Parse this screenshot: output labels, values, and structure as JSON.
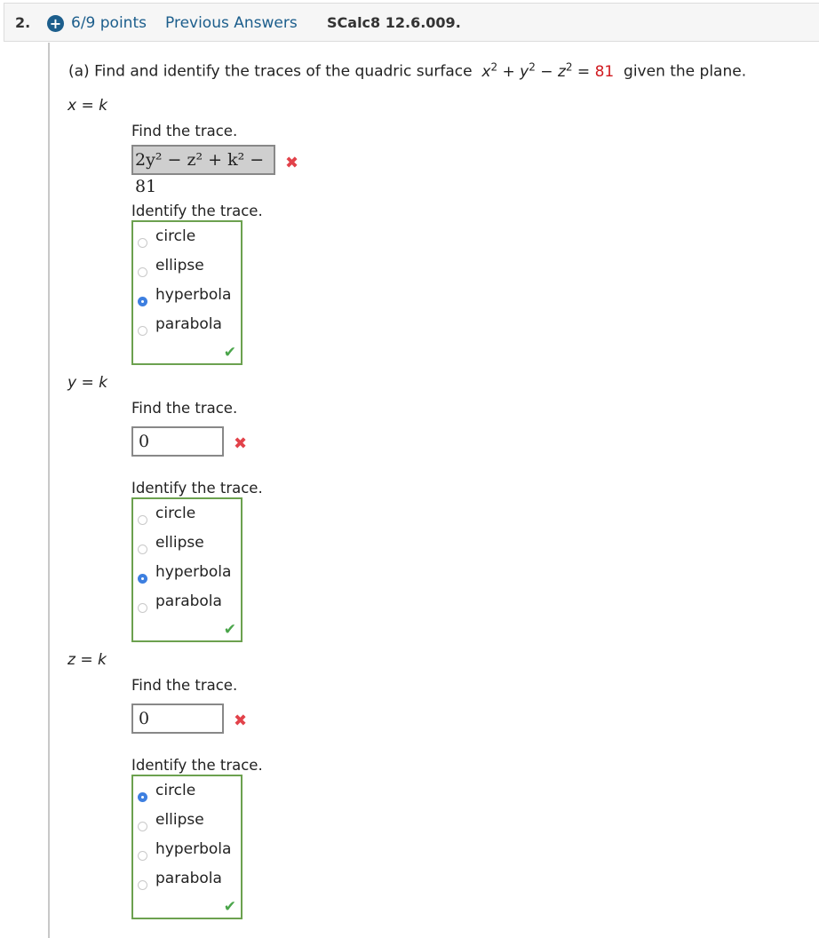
{
  "header": {
    "question_number": "2.",
    "points": "6/9 points",
    "previous_answers": "Previous Answers",
    "source": "SCalc8 12.6.009."
  },
  "question": {
    "prefix": "(a) Find and identify the traces of the quadric surface",
    "equation_lhs": [
      "x",
      "y",
      "z"
    ],
    "exponent": "2",
    "op1": "+",
    "op2": "−",
    "equals": "=",
    "rhs": "81",
    "suffix": "given the plane."
  },
  "parts": [
    {
      "plane": "x = k",
      "find_label": "Find the trace.",
      "answer": "2y² − z² + k² − 81",
      "answer_status": "incorrect",
      "identify_label": "Identify the trace.",
      "options": [
        "circle",
        "ellipse",
        "hyperbola",
        "parabola"
      ],
      "selected": "hyperbola",
      "choice_status": "correct"
    },
    {
      "plane": "y = k",
      "find_label": "Find the trace.",
      "answer": "0",
      "answer_status": "incorrect",
      "identify_label": "Identify the trace.",
      "options": [
        "circle",
        "ellipse",
        "hyperbola",
        "parabola"
      ],
      "selected": "hyperbola",
      "choice_status": "correct"
    },
    {
      "plane": "z = k",
      "find_label": "Find the trace.",
      "answer": "0",
      "answer_status": "incorrect",
      "identify_label": "Identify the trace.",
      "options": [
        "circle",
        "ellipse",
        "hyperbola",
        "parabola"
      ],
      "selected": "circle",
      "choice_status": "correct"
    }
  ],
  "icons": {
    "plus": "+",
    "incorrect": "✖",
    "correct": "✔"
  },
  "colors": {
    "link_blue": "#1c5e8c",
    "incorrect_red": "#e2424a",
    "correct_green": "#6ca14f",
    "radio_selected": "#3d7fe0",
    "rhs_red": "#d0191f"
  }
}
